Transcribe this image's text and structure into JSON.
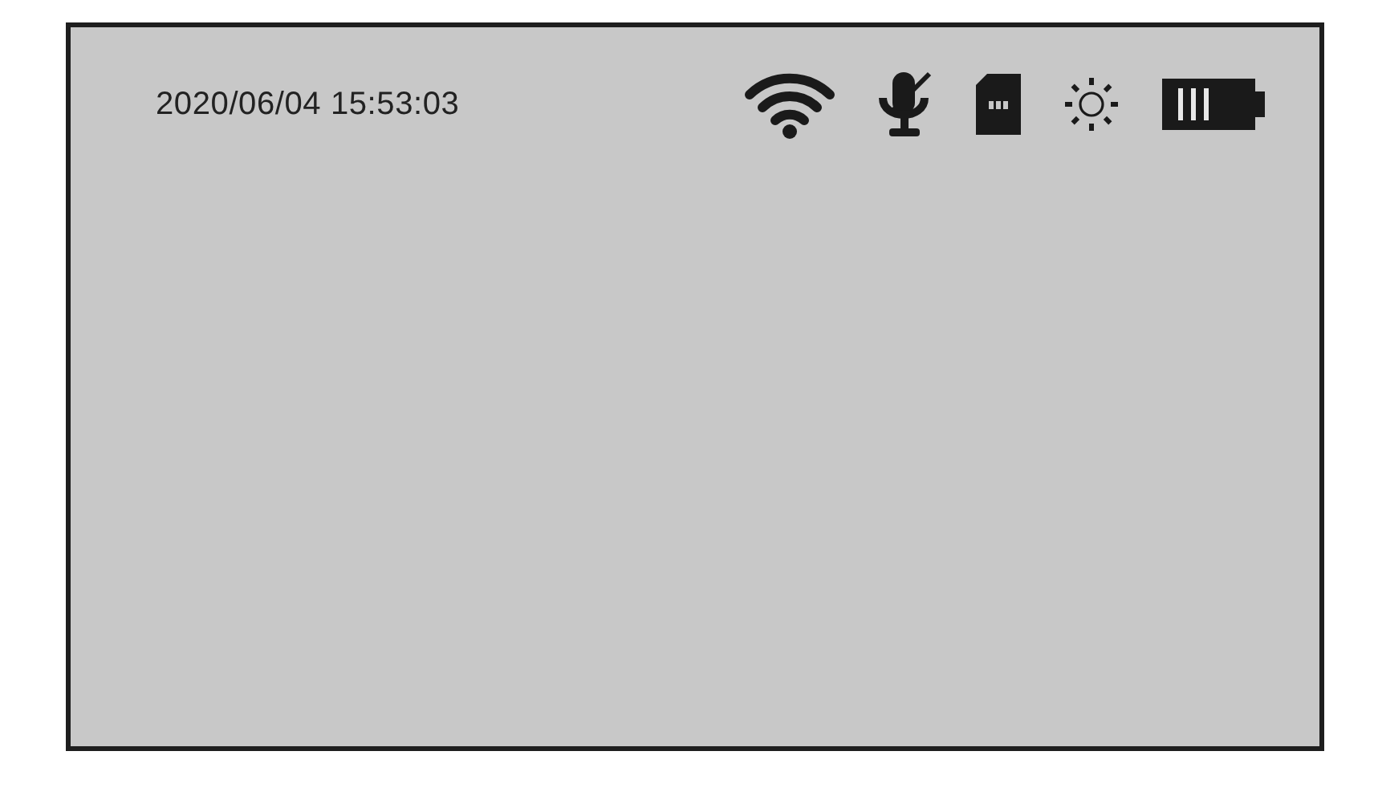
{
  "timestamp": "2020/06/04 15:53:03",
  "status_icons": [
    {
      "kind": "wifi"
    },
    {
      "kind": "microphone",
      "muted": true
    },
    {
      "kind": "sd_card"
    },
    {
      "kind": "brightness"
    },
    {
      "kind": "battery"
    }
  ]
}
